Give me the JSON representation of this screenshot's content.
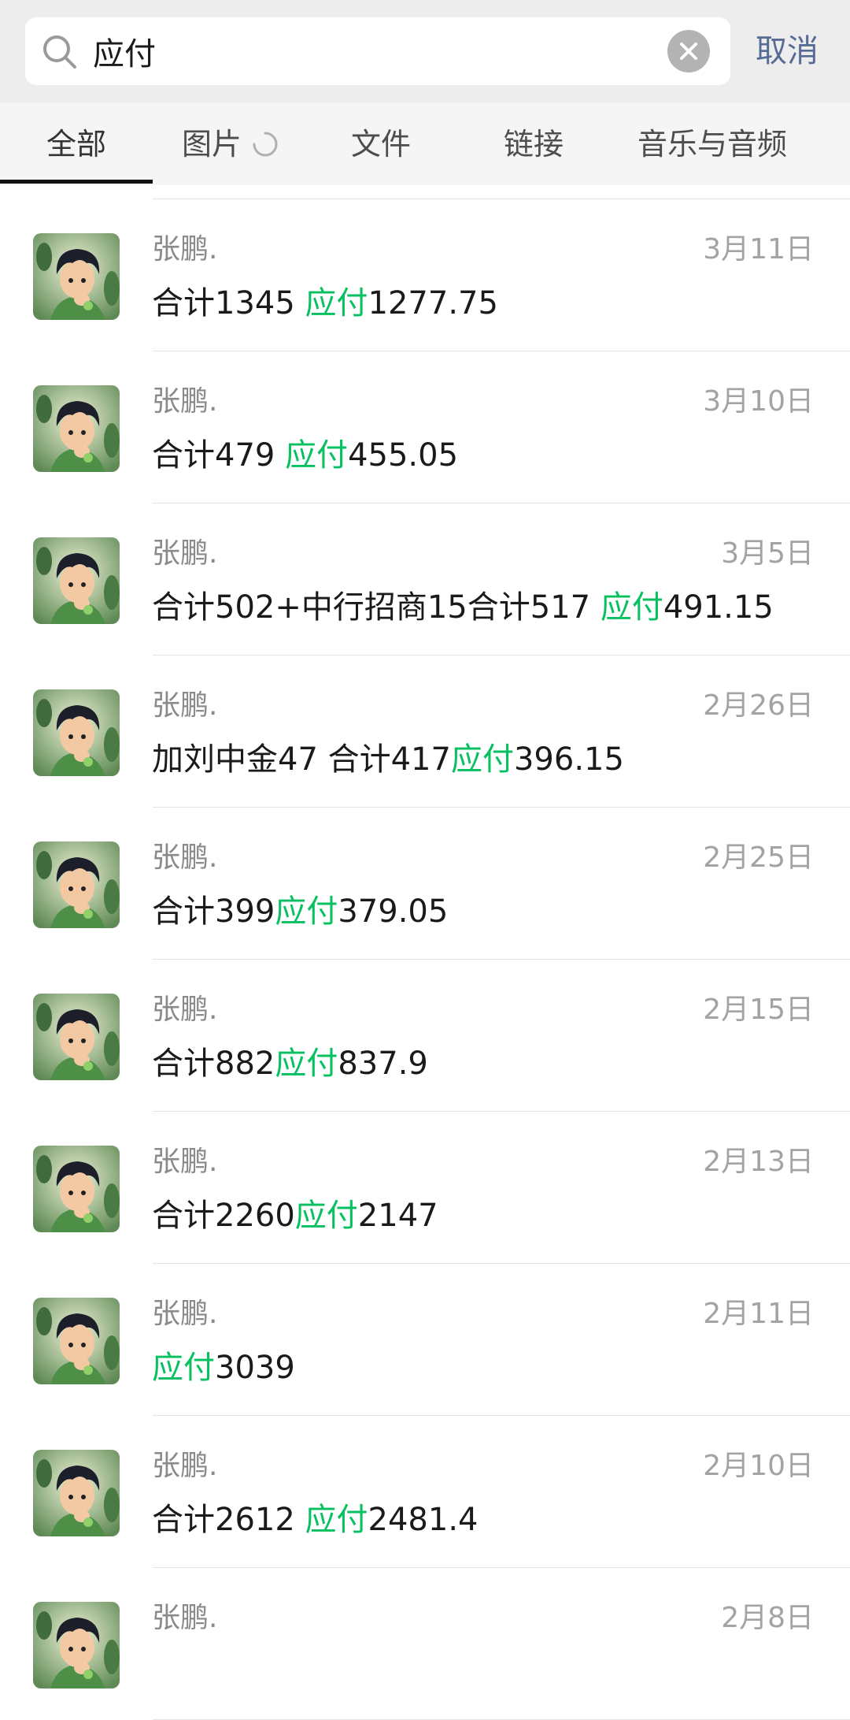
{
  "search": {
    "query": "应付",
    "cancel_label": "取消"
  },
  "tabs": [
    {
      "label": "全部",
      "active": true
    },
    {
      "label": "图片",
      "loading": true
    },
    {
      "label": "文件"
    },
    {
      "label": "链接"
    },
    {
      "label": "音乐与音频"
    }
  ],
  "colors": {
    "highlight": "#07c160",
    "cancel": "#576b95",
    "header_bg": "#ededed"
  },
  "results": [
    {
      "sender": "张鹏.",
      "date": "3月11日",
      "before": "合计1345 ",
      "keyword": "应付",
      "after": "1277.75"
    },
    {
      "sender": "张鹏.",
      "date": "3月10日",
      "before": "合计479 ",
      "keyword": "应付",
      "after": "455.05"
    },
    {
      "sender": "张鹏.",
      "date": "3月5日",
      "before": "合计502+中行招商15合计517 ",
      "keyword": "应付",
      "after": "491.15"
    },
    {
      "sender": "张鹏.",
      "date": "2月26日",
      "before": "加刘中金47 合计417",
      "keyword": "应付",
      "after": "396.15"
    },
    {
      "sender": "张鹏.",
      "date": "2月25日",
      "before": "合计399",
      "keyword": "应付",
      "after": "379.05"
    },
    {
      "sender": "张鹏.",
      "date": "2月15日",
      "before": "合计882",
      "keyword": "应付",
      "after": "837.9"
    },
    {
      "sender": "张鹏.",
      "date": "2月13日",
      "before": "合计2260",
      "keyword": "应付",
      "after": "2147"
    },
    {
      "sender": "张鹏.",
      "date": "2月11日",
      "before": "",
      "keyword": "应付",
      "after": "3039"
    },
    {
      "sender": "张鹏.",
      "date": "2月10日",
      "before": "合计2612 ",
      "keyword": "应付",
      "after": "2481.4"
    },
    {
      "sender": "张鹏.",
      "date": "2月8日",
      "before": "",
      "keyword": "",
      "after": ""
    }
  ]
}
